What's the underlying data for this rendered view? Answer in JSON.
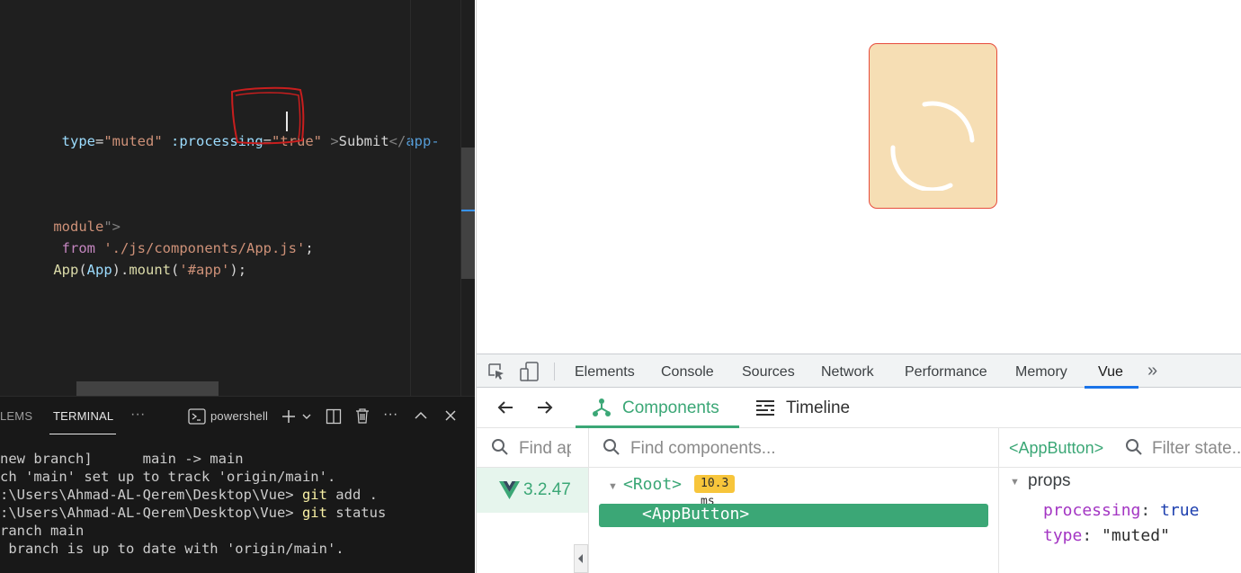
{
  "editor": {
    "line1": {
      "p1": " type",
      "p2": "=",
      "p3": "\"muted\"",
      "p4": " :processing",
      "p5": "=",
      "p6": "\"true\"",
      "p7": " >",
      "p8": "Submit",
      "p9": "</",
      "p10": "app-"
    },
    "line2": {
      "p1": "module",
      "p2": "\">"
    },
    "line3": {
      "p1": " from",
      "p2": " ",
      "p3": "'./js/components/App.js'",
      "p4": ";"
    },
    "line4": {
      "p1": "App",
      "p2": "(",
      "p3": "App",
      "p4": ").",
      "p5": "mount",
      "p6": "(",
      "p7": "'#app'",
      "p8": ");"
    }
  },
  "panel": {
    "tabs": {
      "problems": "LEMS",
      "terminal": "TERMINAL",
      "more": "···"
    },
    "terminal_name": "powershell",
    "lines": {
      "l1": "new branch]      main -> main",
      "l2": "ch 'main' set up to track 'origin/main'.",
      "l3_prefix": ":\\Users\\Ahmad-AL-Qerem\\Desktop\\Vue> ",
      "l3_cmd": "git",
      "l3_rest": " add .",
      "l4_prefix": ":\\Users\\Ahmad-AL-Qerem\\Desktop\\Vue> ",
      "l4_cmd": "git",
      "l4_rest": " status",
      "l5": "ranch main",
      "l6": " branch is up to date with 'origin/main'."
    }
  },
  "devtools": {
    "tabs": [
      "Elements",
      "Console",
      "Sources",
      "Network",
      "Performance",
      "Memory",
      "Vue"
    ],
    "active_tab": "Vue",
    "more_tabs": "»",
    "vue": {
      "tabs": {
        "components": "Components",
        "timeline": "Timeline"
      },
      "app_search_placeholder": "Find apps...",
      "components_search_placeholder": "Find components...",
      "state_search_placeholder": "Filter state...",
      "version": "3.2.47",
      "tree": {
        "root": "<Root>",
        "render_time": "10.3 ms",
        "child": "<AppButton>"
      },
      "inspector": {
        "selected": "<AppButton>",
        "section": "props",
        "props": [
          {
            "key": "processing",
            "value": "true"
          },
          {
            "key": "type",
            "value": "\"muted\""
          }
        ]
      }
    }
  },
  "colors": {
    "vue_green": "#3ba776",
    "button_bg": "#f6deb4",
    "button_border": "#e74c3c",
    "badge": "#f7c53b",
    "devtools_active": "#1a73e8"
  }
}
